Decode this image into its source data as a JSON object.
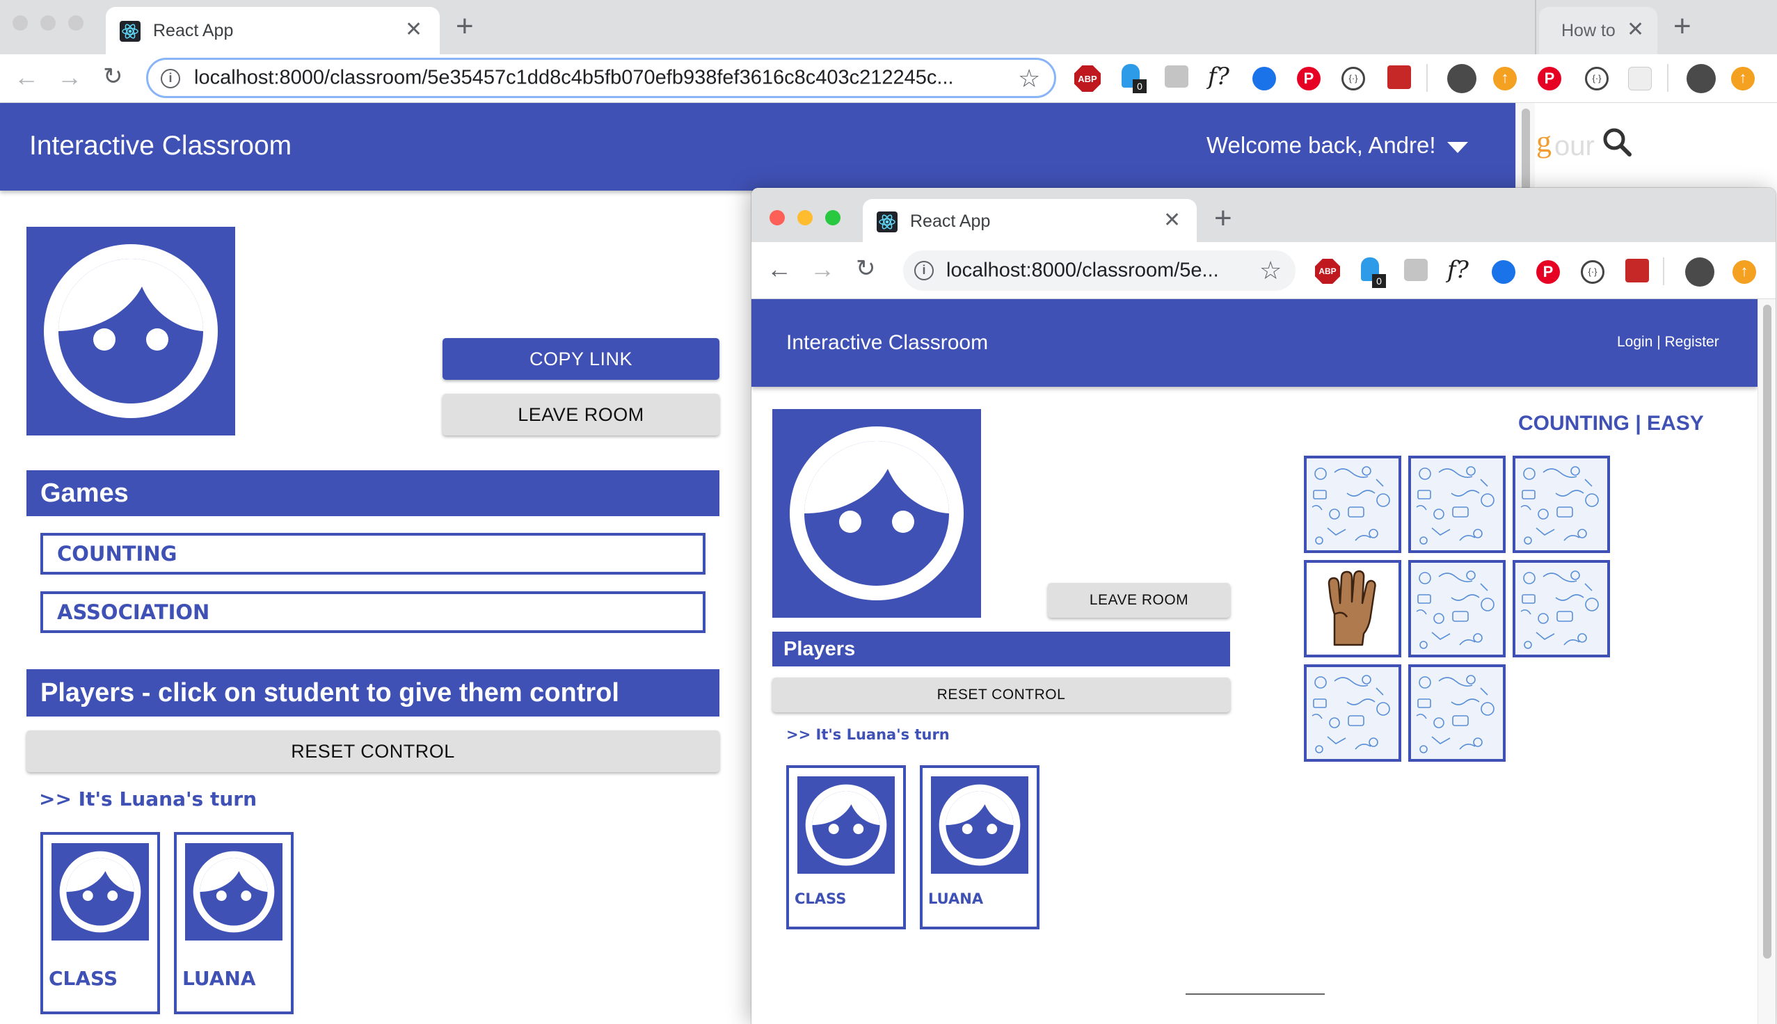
{
  "browser_back": {
    "tabs": [
      {
        "title": "React App"
      },
      {
        "title": "How to"
      }
    ],
    "url": "localhost:8000/classroom/5e35457c1dd8c4b5fb070efb938fef3616c8c403c212245c...",
    "ext_badge": "0",
    "ext_formula": "f?",
    "abp": "ABP"
  },
  "teacher_app": {
    "title": "Interactive Classroom",
    "welcome": "Welcome back, Andre!",
    "copy_link": "COPY LINK",
    "leave_room": "LEAVE ROOM",
    "games_heading": "Games",
    "games": [
      "COUNTING",
      "ASSOCIATION"
    ],
    "players_heading": "Players - click on student to give them control",
    "reset_control": "RESET CONTROL",
    "turn_text": ">> It's Luana's turn",
    "players": [
      "CLASS",
      "LUANA"
    ]
  },
  "browser_front": {
    "tab_title": "React App",
    "url": "localhost:8000/classroom/5e...",
    "ext_badge": "0",
    "ext_formula": "f?",
    "abp": "ABP"
  },
  "student_app": {
    "title": "Interactive Classroom",
    "login": "Login | Register",
    "leave_room": "LEAVE ROOM",
    "players_heading": "Players",
    "reset_control": "RESET CONTROL",
    "turn_text": ">> It's Luana's turn",
    "players": [
      "CLASS",
      "LUANA"
    ],
    "game_title": "COUNTING | EASY",
    "tiles_count": 8,
    "revealed_tile_index": 3,
    "revealed_tile_content": "hand-four-fingers"
  },
  "colors": {
    "primary": "#3f51b5",
    "grey_button": "#e0e0e0"
  }
}
